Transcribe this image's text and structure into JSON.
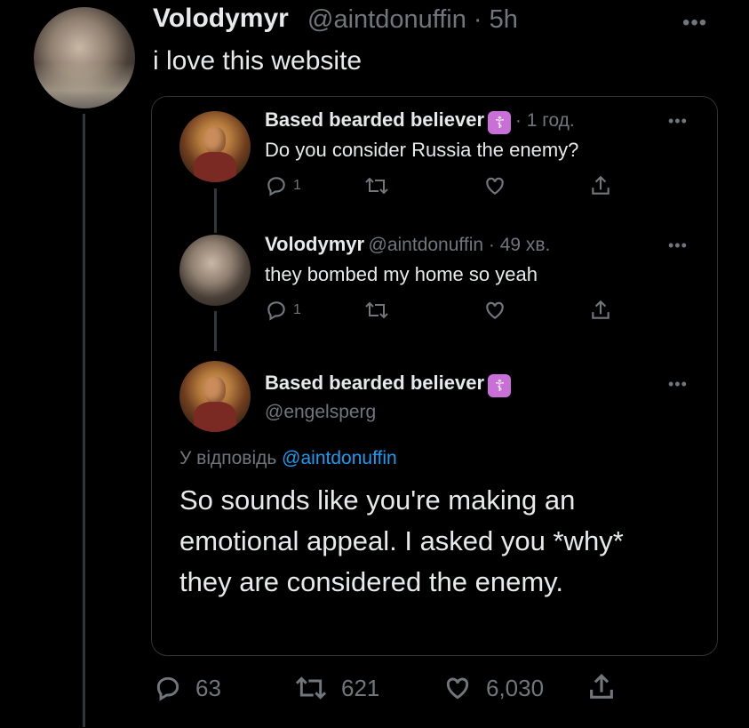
{
  "main_tweet": {
    "name": "Volodymyr",
    "handle_time": "@aintdonuffin · 5h",
    "text": "i love this website",
    "more": "•••"
  },
  "thread": [
    {
      "name": "Based bearded believer",
      "badge": "☦",
      "meta": "· 1 год.",
      "text": "Do you consider Russia the enemy?",
      "reply_count": "1",
      "more": "•••"
    },
    {
      "name": "Volodymyr",
      "meta": "@aintdonuffin · 49 хв.",
      "text": "they bombed my home so yeah",
      "reply_count": "1",
      "more": "•••"
    },
    {
      "name": "Based bearded believer",
      "badge": "☦",
      "handle": "@engelsperg",
      "more": "•••",
      "reply_prefix": "У відповідь",
      "reply_mention": "@aintdonuffin",
      "text": "So sounds like you're making an emotional appeal. I asked you *why* they are considered the enemy."
    }
  ],
  "stats": {
    "replies": "63",
    "retweets": "621",
    "likes": "6,030"
  },
  "colors": {
    "background": "#000000",
    "text": "#e7e9ea",
    "muted": "#71767b",
    "link": "#1d9bf0",
    "badge": "#c86fd8",
    "border": "#2f3336"
  }
}
